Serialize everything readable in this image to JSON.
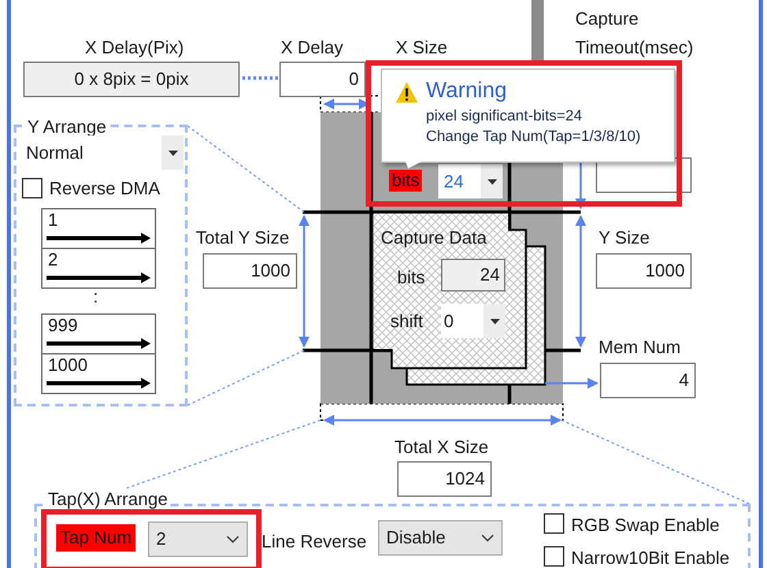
{
  "x_delay_pix": {
    "label": "X Delay(Pix)",
    "value": "0 x 8pix = 0pix"
  },
  "x_delay": {
    "label": "X Delay",
    "value": "0"
  },
  "x_size": {
    "label": "X Size"
  },
  "capture_timeout": {
    "label_lines": [
      "Capture",
      "Timeout(msec)"
    ]
  },
  "y_arrange": {
    "label": "Y Arrange",
    "mode": "Normal",
    "reverse_dma": {
      "label": "Reverse DMA",
      "checked": false
    },
    "rows": [
      {
        "kind": "line",
        "label": "1"
      },
      {
        "kind": "line",
        "label": "2"
      },
      {
        "kind": "gap",
        "label": ":"
      },
      {
        "kind": "line",
        "label": "999"
      },
      {
        "kind": "line",
        "label": "1000"
      }
    ]
  },
  "total_y_size": {
    "label": "Total Y Size",
    "value": "1000"
  },
  "capture_data": {
    "title": "Capture Data",
    "bits": {
      "label": "bits",
      "value": "24"
    },
    "shift": {
      "label": "shift",
      "value": "0"
    }
  },
  "y_size": {
    "label": "Y Size",
    "value": "1000"
  },
  "mem_num": {
    "label": "Mem Num",
    "value": "4"
  },
  "total_x_size": {
    "label": "Total X Size",
    "value": "1024"
  },
  "pixel_bits": {
    "label": "bits",
    "value": "24",
    "error": true
  },
  "warning": {
    "title": "Warning",
    "lines": [
      "pixel significant-bits=24",
      "Change Tap Num(Tap=1/3/8/10)"
    ],
    "highlighted": true
  },
  "tap_arrange": {
    "label": "Tap(X) Arrange",
    "tap_num": {
      "label": "Tap Num",
      "value": "2",
      "error": true,
      "highlighted": true
    },
    "line_reverse": {
      "label": "Line Reverse",
      "value": "Disable"
    },
    "options": [
      {
        "label": "RGB Swap Enable",
        "checked": false
      },
      {
        "label": "Narrow10Bit Enable",
        "checked": false
      }
    ]
  }
}
